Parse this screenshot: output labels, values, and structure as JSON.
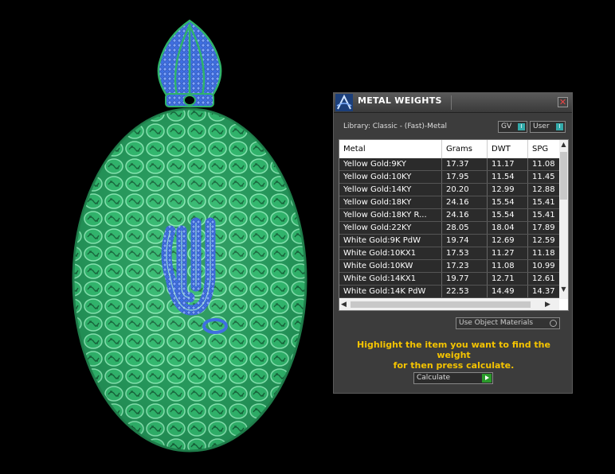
{
  "window": {
    "title": "METAL WEIGHTS",
    "close_glyph": "✕"
  },
  "library": {
    "label": "Library: Classic - (Fast)-Metal"
  },
  "toggles": {
    "gv_label": "GV",
    "user_label": "User"
  },
  "table": {
    "headers": [
      "Metal",
      "Grams",
      "DWT",
      "SPG"
    ],
    "rows": [
      [
        "Yellow Gold:9KY",
        "17.37",
        "11.17",
        "11.08"
      ],
      [
        "Yellow Gold:10KY",
        "17.95",
        "11.54",
        "11.45"
      ],
      [
        "Yellow Gold:14KY",
        "20.20",
        "12.99",
        "12.88"
      ],
      [
        "Yellow Gold:18KY",
        "24.16",
        "15.54",
        "15.41"
      ],
      [
        "Yellow Gold:18KY R...",
        "24.16",
        "15.54",
        "15.41"
      ],
      [
        "Yellow Gold:22KY",
        "28.05",
        "18.04",
        "17.89"
      ],
      [
        "White Gold:9K PdW",
        "19.74",
        "12.69",
        "12.59"
      ],
      [
        "White Gold:10KX1",
        "17.53",
        "11.27",
        "11.18"
      ],
      [
        "White Gold:10KW",
        "17.23",
        "11.08",
        "10.99"
      ],
      [
        "White Gold:14KX1",
        "19.77",
        "12.71",
        "12.61"
      ],
      [
        "White Gold:14K PdW",
        "22.53",
        "14.49",
        "14.37"
      ]
    ]
  },
  "options": {
    "use_object_materials_label": "Use Object Materials"
  },
  "instructions": {
    "line1": "Highlight the item you want to find the weight",
    "line2": "for then press calculate."
  },
  "actions": {
    "calculate_label": "Calculate"
  },
  "colors": {
    "model_green": "#3ec27a",
    "model_blue": "#2f5fd0",
    "instruction_yellow": "#f5c400"
  }
}
